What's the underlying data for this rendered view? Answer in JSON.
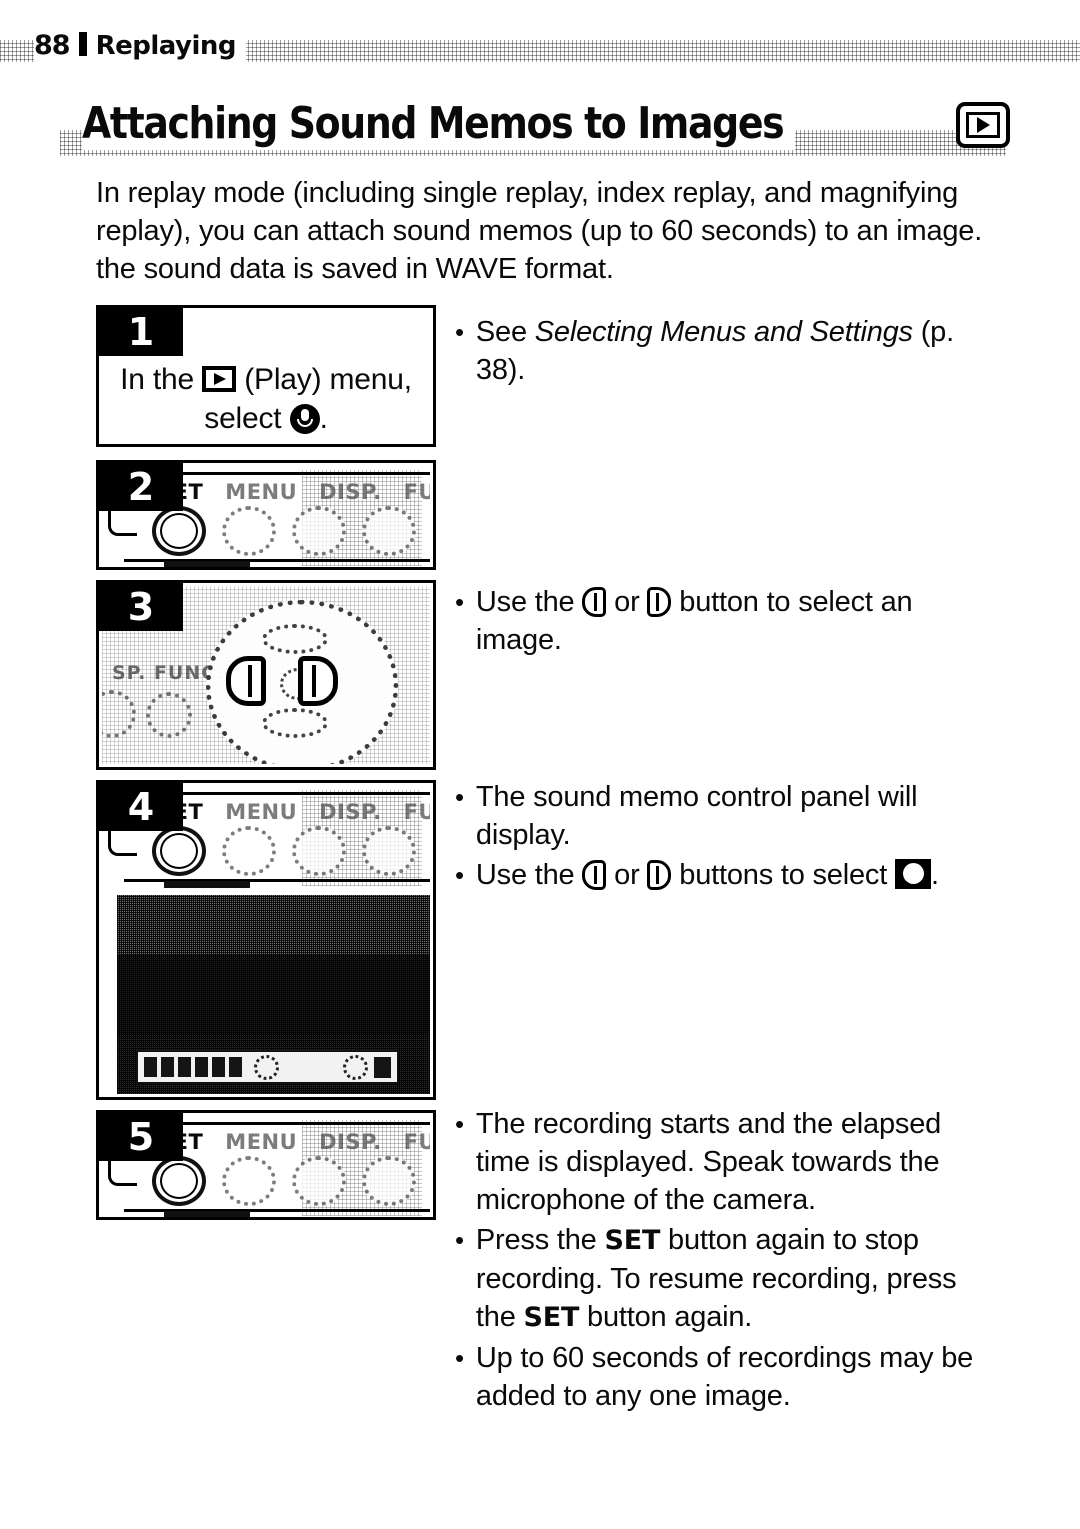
{
  "header": {
    "page_number": "88",
    "section": "Replaying"
  },
  "title": {
    "text": "Attaching Sound Memos to Images",
    "badge_icon": "play-mode-icon"
  },
  "intro": {
    "paragraph": "In replay mode (including single replay, index replay, and magnifying replay), you can attach sound memos (up to 60 seconds) to an image. the sound data is saved in WAVE format."
  },
  "steps": [
    {
      "number": "1",
      "type": "text",
      "line1_prefix": "In the",
      "line1_icon": "play-icon",
      "line1_suffix": "(Play) menu,",
      "line2_prefix": "select",
      "line2_icon": "microphone-icon",
      "line2_suffix": "."
    },
    {
      "number": "2",
      "type": "camera-buttons",
      "button_labels": [
        "SET",
        "MENU",
        "DISP.",
        "FUNC."
      ]
    },
    {
      "number": "3",
      "type": "camera-dial",
      "side_label": "SP. FUNC."
    },
    {
      "number": "4",
      "type": "camera-buttons-with-lcd",
      "button_labels": [
        "SET",
        "MENU",
        "DISP.",
        "FUNC."
      ]
    },
    {
      "number": "5",
      "type": "camera-buttons",
      "button_labels": [
        "SET",
        "MENU",
        "DISP.",
        "FUNC."
      ]
    }
  ],
  "notes": {
    "step1": [
      {
        "bullet": "•",
        "parts": [
          {
            "text": "See ",
            "style": "normal"
          },
          {
            "text": "Selecting Menus and Settings",
            "style": "italic"
          },
          {
            "text": " (p. 38).",
            "style": "normal"
          }
        ]
      }
    ],
    "step3": [
      {
        "bullet": "•",
        "prefix": "Use the",
        "icon_a": "dpad-left-icon",
        "middle": "or",
        "icon_b": "dpad-right-icon",
        "suffix": "button to select an image."
      }
    ],
    "step4": [
      {
        "bullet": "•",
        "text": "The sound memo control panel will display."
      },
      {
        "bullet": "•",
        "prefix": "Use the",
        "icon_a": "dpad-left-icon",
        "middle": "or",
        "icon_b": "dpad-right-icon",
        "suffix_before_icon": "buttons to select",
        "icon_c": "record-icon",
        "suffix_after_icon": "."
      }
    ],
    "step5": [
      {
        "bullet": "•",
        "text": "The recording starts and the elapsed time is displayed. Speak towards the microphone of the camera."
      },
      {
        "bullet": "•",
        "part1": "Press the ",
        "bold1": "SET",
        "part2": " button again to stop recording. To resume recording, press the ",
        "bold2": "SET",
        "part3": " button again."
      },
      {
        "bullet": "•",
        "text": "Up to 60 seconds of recordings may be added to any one image."
      }
    ]
  }
}
